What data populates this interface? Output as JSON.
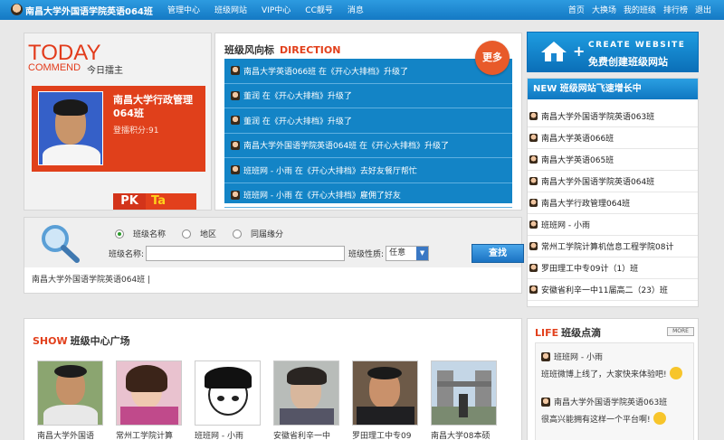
{
  "topbar": {
    "site_title": "南昌大学外国语学院英语064班",
    "nav": [
      "管理中心",
      "班级网站",
      "VIP中心",
      "CC靓号",
      "消息"
    ],
    "right": [
      "首页",
      "大换场",
      "我的班级",
      "排行榜",
      "退出"
    ]
  },
  "today": {
    "title_en": "TODAY",
    "commend_en": "COMMEND",
    "commend_cn": "今日擂主",
    "name": "南昌大学行政管理064班",
    "score": "登擂积分:91",
    "pk": "PK",
    "ta": "Ta"
  },
  "direction": {
    "title_cn": "班级风向标",
    "title_en": "DIRECTION",
    "more": "更多",
    "items": [
      "南昌大学英语066班 在《开心大排档》升级了",
      "董润 在《开心大排档》升级了",
      "董润 在《开心大排档》升级了",
      "南昌大学外国语学院英语064班 在《开心大排档》升级了",
      "班班网 - 小雨 在《开心大排档》去好友餐厅帮忙",
      "班班网 - 小雨 在《开心大排档》雇佣了好友"
    ]
  },
  "create_site": {
    "en": "CREATE WEBSITE",
    "cn": "免费创建班级网站"
  },
  "new_classes": {
    "title": "NEW 班级网站飞速增长中",
    "items": [
      "南昌大学外国语学院英语063班",
      "南昌大学英语066班",
      "南昌大学英语065班",
      "南昌大学外国语学院英语064班",
      "南昌大学行政管理064班",
      "班班网 - 小雨",
      "常州工学院计算机信息工程学院08计",
      "罗田理工中专09计（1）班",
      "安徽省利辛一中11届高二（23）班"
    ]
  },
  "search": {
    "radios": [
      "班级名称",
      "地区",
      "同届缘分"
    ],
    "name_label": "班级名称:",
    "name_value": "",
    "type_label": "班级性质:",
    "type_value": "任意",
    "button": "查找",
    "result": "南昌大学外国语学院英语064班 |"
  },
  "show": {
    "title_en": "SHOW",
    "title_cn": "班级中心广场",
    "items": [
      "南昌大学外国语",
      "常州工学院计算",
      "班班网 - 小雨",
      "安徽省利辛一中",
      "罗田理工中专09",
      "南昌大学08本硕"
    ]
  },
  "life": {
    "title_en": "LIFE",
    "title_cn": "班级点滴",
    "more": "MORE",
    "items": [
      {
        "who": "班班网 - 小雨",
        "msg": "班班微博上线了，大家快来体验吧!"
      },
      {
        "who": "南昌大学外国语学院英语063班",
        "msg": "很高兴能拥有这样一个平台啊!"
      }
    ]
  }
}
